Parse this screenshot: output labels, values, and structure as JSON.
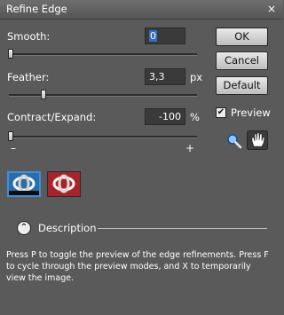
{
  "window": {
    "title": "Refine Edge",
    "close_icon": "×"
  },
  "controls": {
    "smooth": {
      "label": "Smooth:",
      "value": "0",
      "unit": "",
      "level": 0
    },
    "feather": {
      "label": "Feather:",
      "value": "3,3",
      "unit": "px",
      "level": 0.13
    },
    "contract_expand": {
      "label": "Contract/Expand:",
      "value": "-100",
      "unit": "%",
      "level": 0,
      "minus": "–",
      "plus": "+"
    }
  },
  "buttons": {
    "ok": "OK",
    "cancel": "Cancel",
    "default": "Default"
  },
  "preview": {
    "label": "Preview",
    "checked": true,
    "checkmark": "✔"
  },
  "tools": [
    "zoom-icon",
    "hand-icon"
  ],
  "view_modes": [
    "selection-view-icon",
    "mask-view-icon"
  ],
  "description": {
    "label": "Description",
    "toggle": "⌃"
  },
  "help_text": "Press P to toggle the preview of the edge refinements. Press F to cycle through the preview modes, and X to temporarily view the image.",
  "colors": {
    "background": "#5a5a5a",
    "accent": "#3d8fe0",
    "mask": "#a8232a"
  }
}
